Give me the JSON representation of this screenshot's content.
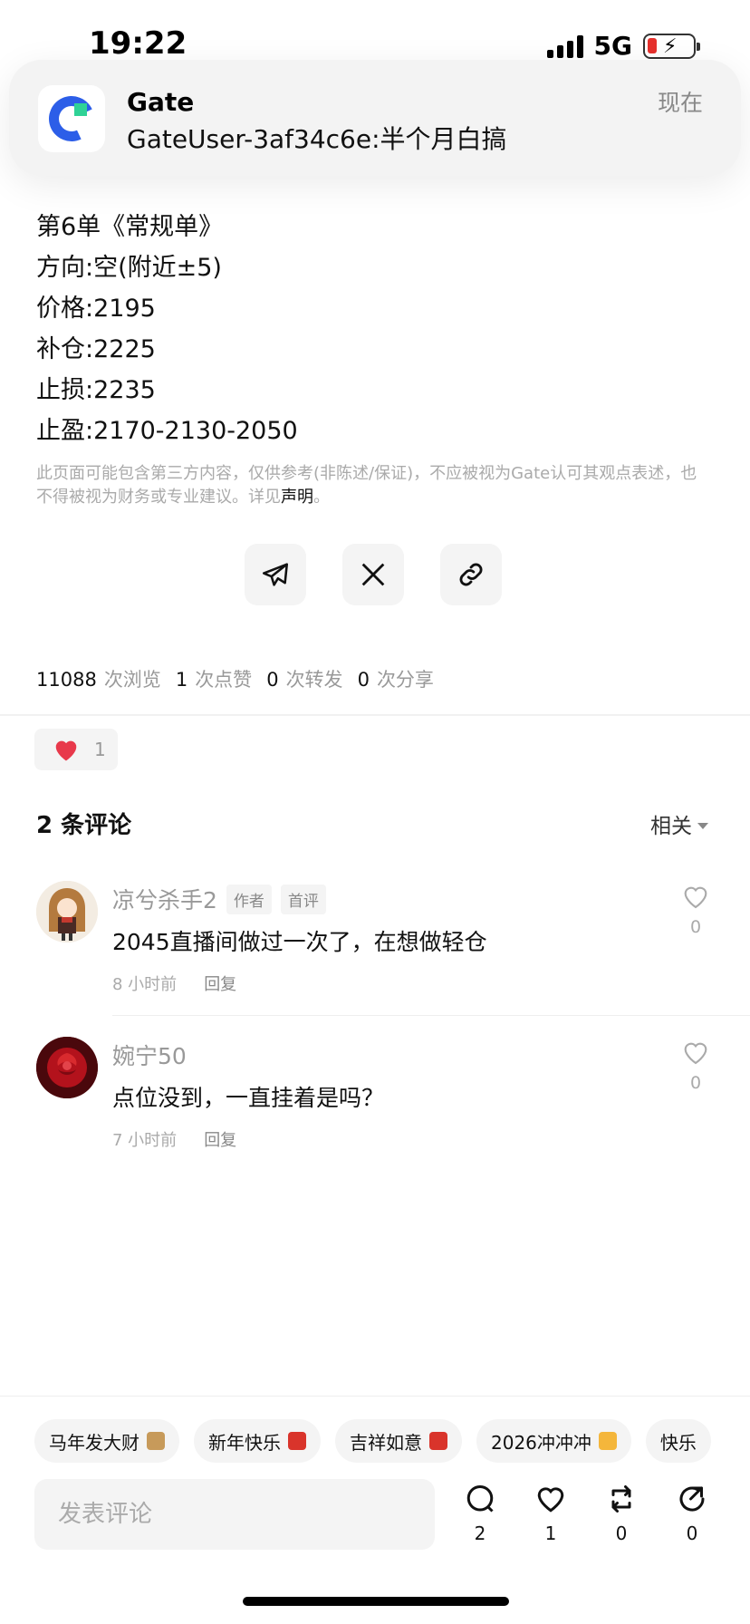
{
  "status_bar": {
    "time": "19:22",
    "network": "5G"
  },
  "notification": {
    "app_name": "Gate",
    "message": "GateUser-3af34c6e:半个月白搞",
    "time": "现在"
  },
  "post": {
    "lines": [
      "第6单《常规单》",
      "方向:空(附近±5)",
      "价格:2195",
      "补仓:2225",
      "止损:2235",
      "止盈:2170-2130-2050"
    ],
    "disclaimer": "此页面可能包含第三方内容，仅供参考(非陈述/保证)，不应被视为Gate认可其观点表述，也不得被视为财务或专业建议。详见",
    "disclaimer_link": "声明",
    "disclaimer_end": "。"
  },
  "share": {
    "icons": [
      "telegram-icon",
      "x-icon",
      "link-icon"
    ]
  },
  "stats": [
    {
      "value": "11088",
      "label": "次浏览"
    },
    {
      "value": "1",
      "label": "次点赞"
    },
    {
      "value": "0",
      "label": "次转发"
    },
    {
      "value": "0",
      "label": "次分享"
    }
  ],
  "reactions": {
    "heart_count": "1"
  },
  "comments_header": {
    "title": "2 条评论",
    "sort": "相关"
  },
  "comments": [
    {
      "user": "凉兮杀手2",
      "tags": [
        "作者",
        "首评"
      ],
      "text": "2045直播间做过一次了，在想做轻仓",
      "time": "8 小时前",
      "reply": "回复",
      "likes": "0"
    },
    {
      "user": "婉宁50",
      "tags": [],
      "text": "点位没到，一直挂着是吗？",
      "time": "7 小时前",
      "reply": "回复",
      "likes": "0"
    }
  ],
  "quick_chips": [
    {
      "label": "马年发大财",
      "emoji_color": "#c79a5a"
    },
    {
      "label": "新年快乐",
      "emoji_color": "#d9342b"
    },
    {
      "label": "吉祥如意",
      "emoji_color": "#d9342b"
    },
    {
      "label": "2026冲冲冲",
      "emoji_color": "#f4b63b"
    },
    {
      "label": "快乐",
      "emoji_color": "#f4b63b"
    }
  ],
  "composer": {
    "placeholder": "发表评论"
  },
  "actions": [
    {
      "icon": "comment-icon",
      "count": "2"
    },
    {
      "icon": "heart-icon",
      "count": "1"
    },
    {
      "icon": "repost-icon",
      "count": "0"
    },
    {
      "icon": "share-icon",
      "count": "0"
    }
  ],
  "colors": {
    "brand_blue": "#2c5ee8",
    "brand_green": "#2fd296",
    "heart_red": "#e8394b"
  }
}
